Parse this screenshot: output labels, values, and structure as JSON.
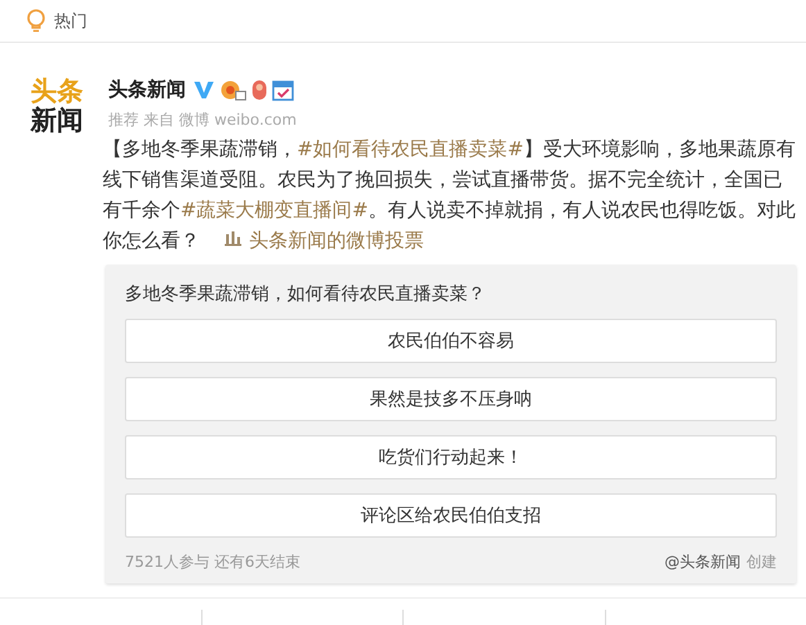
{
  "header": {
    "title": "热门"
  },
  "post": {
    "logo": [
      "头条",
      "新闻"
    ],
    "author": "头条新闻",
    "meta": "推荐 来自 微博 weibo.com",
    "body": [
      {
        "kind": "plain",
        "text": "【多地冬季果蔬滞销，"
      },
      {
        "kind": "topic",
        "text": "#如何看待农民直播卖菜#"
      },
      {
        "kind": "plain",
        "text": "】受大环境影响，多地果蔬原有线下销售渠道受阻。农民为了挽回损失，尝试直播带货。据不完全统计，全国已有千余个"
      },
      {
        "kind": "topic",
        "text": "#蔬菜大棚变直播间#"
      },
      {
        "kind": "plain",
        "text": "。有人说卖不掉就捐，有人说农民也得吃饭。对此你怎么看？ "
      },
      {
        "kind": "poll",
        "text": "头条新闻的微博投票"
      }
    ]
  },
  "poll": {
    "question": "多地冬季果蔬滞销，如何看待农民直播卖菜？",
    "options": [
      "农民伯伯不容易",
      "果然是技多不压身呐",
      "吃货们行动起来！",
      "评论区给农民伯伯支招"
    ],
    "stats": "7521人参与 还有6天结束",
    "creator": "@头条新闻",
    "created": "创建"
  }
}
